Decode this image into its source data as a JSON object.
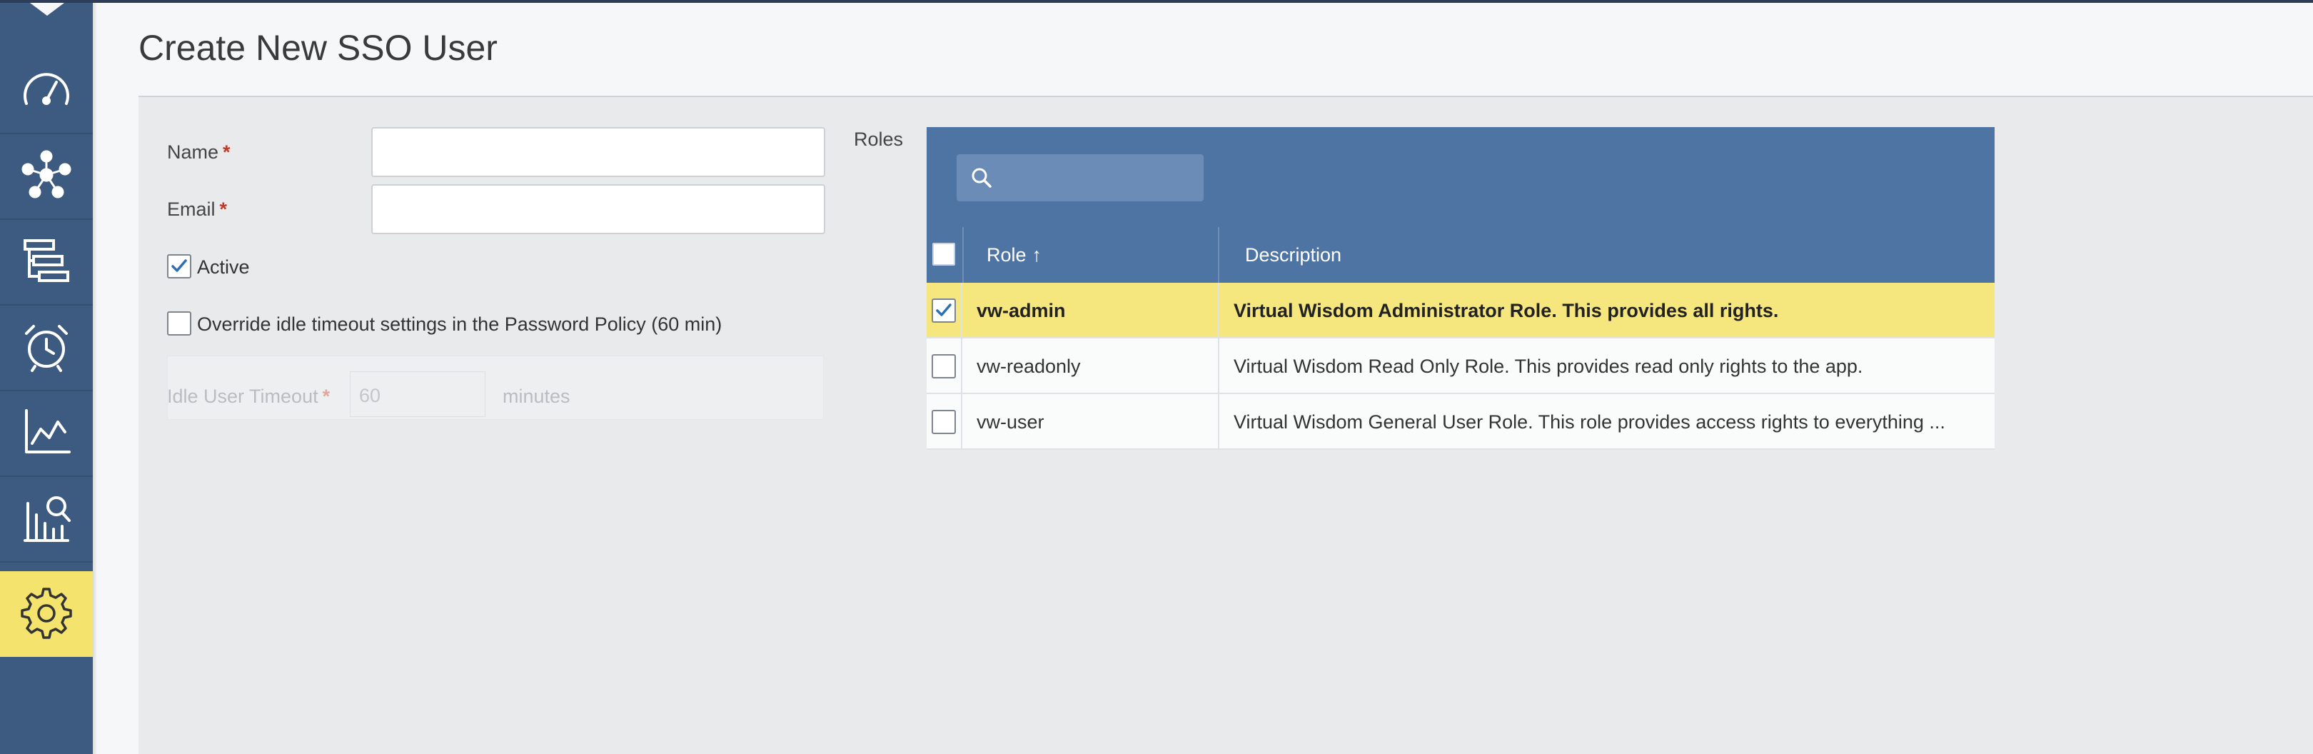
{
  "header": {
    "title": "Create New SSO User"
  },
  "sidebar": {
    "items": [
      {
        "icon": "dashboard-gauge-icon"
      },
      {
        "icon": "topology-icon"
      },
      {
        "icon": "entities-list-icon"
      },
      {
        "icon": "alarm-clock-icon"
      },
      {
        "icon": "trend-chart-icon"
      },
      {
        "icon": "analytics-search-icon"
      },
      {
        "icon": "gear-icon",
        "active": true
      }
    ]
  },
  "form": {
    "name_label": "Name",
    "email_label": "Email",
    "required_mark": "*",
    "name_value": "",
    "email_value": "",
    "active_label": "Active",
    "active_checked": true,
    "override_label": "Override idle timeout settings in the Password Policy (60 min)",
    "override_checked": false,
    "idle_timeout_label": "Idle User Timeout",
    "idle_timeout_value": "60",
    "idle_timeout_unit": "minutes"
  },
  "roles": {
    "label": "Roles",
    "search_placeholder": "",
    "columns": {
      "role": "Role",
      "description": "Description",
      "sort_indicator": "↑"
    },
    "rows": [
      {
        "role": "vw-admin",
        "description": "Virtual Wisdom Administrator Role. This provides all rights.",
        "checked": true
      },
      {
        "role": "vw-readonly",
        "description": "Virtual Wisdom Read Only Role. This provides read only rights to the app.",
        "checked": false
      },
      {
        "role": "vw-user",
        "description": "Virtual Wisdom General User Role. This role provides access rights to everything ...",
        "checked": false
      }
    ]
  },
  "colors": {
    "sidebar": "#3d5a80",
    "accent_yellow": "#f4e36c",
    "table_header": "#4e74a4",
    "required": "#c0392b"
  }
}
